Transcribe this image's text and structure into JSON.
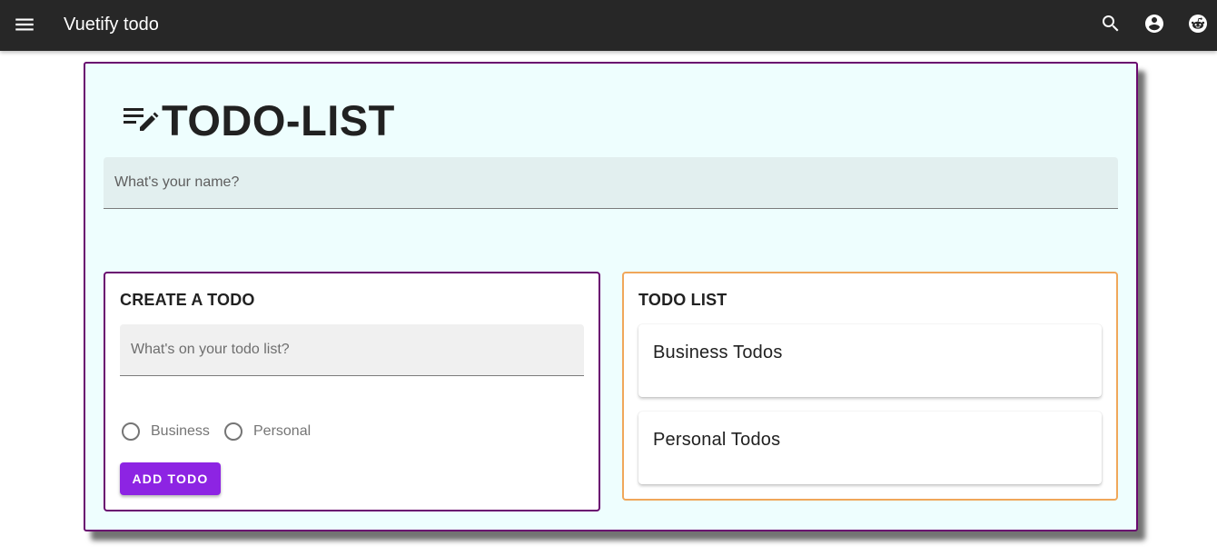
{
  "appbar": {
    "title": "Vuetify todo",
    "icons": [
      "menu-icon",
      "search-icon",
      "account-circle-icon",
      "reddit-icon"
    ],
    "background": "#272727"
  },
  "main": {
    "heading": "TODO-LIST",
    "heading_icon": "playlist-edit-icon",
    "name_input": {
      "placeholder": "What's your name?",
      "value": ""
    },
    "accent_purple": "#6a0a70",
    "accent_orange": "#f0a75a"
  },
  "create_card": {
    "title": "CREATE A TODO",
    "todo_input": {
      "placeholder": "What's on your todo list?",
      "value": ""
    },
    "radios": [
      {
        "label": "Business",
        "checked": false
      },
      {
        "label": "Personal",
        "checked": false
      }
    ],
    "add_button_label": "ADD TODO",
    "button_color": "#8d24e3"
  },
  "list_card": {
    "title": "TODO LIST",
    "groups": [
      {
        "title": "Business Todos"
      },
      {
        "title": "Personal Todos"
      }
    ]
  }
}
